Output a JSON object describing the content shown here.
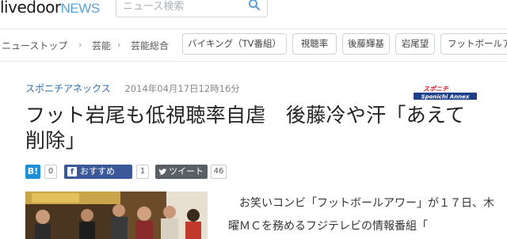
{
  "header": {
    "logo_main": "livedoor",
    "logo_sub": "NEWS",
    "search_placeholder": "ニュース検索"
  },
  "breadcrumb": {
    "items": [
      "ニューストップ",
      "芸能",
      "芸能総合"
    ]
  },
  "tags": [
    "バイキング（TV番組）",
    "視聴率",
    "後藤輝基",
    "岩尾望",
    "フットボールア"
  ],
  "article": {
    "source": "スポニチアネックス",
    "datetime": "2014年04月17日12時16分",
    "title": "フット岩尾も低視聴率自虐　後藤冷や汗「あえて削除」",
    "lead": "お笑いコンビ「フットボールアワー」が１７日、木曜ＭＣを務めるフジテレビの情報番組「",
    "badge": {
      "top": "スポニチ",
      "bottom": "Sponichi Annex"
    }
  },
  "social": {
    "hatena": {
      "label": "B!",
      "count": "0"
    },
    "facebook": {
      "label": "おすすめ",
      "count": "1"
    },
    "twitter": {
      "label": "ツイート",
      "count": "46"
    }
  },
  "colors": {
    "link": "#2a6fb0",
    "logo_sub": "#5aa0d8",
    "hatena": "#1d8fd6",
    "facebook": "#3b5998",
    "twitter": "#5a5f63"
  }
}
